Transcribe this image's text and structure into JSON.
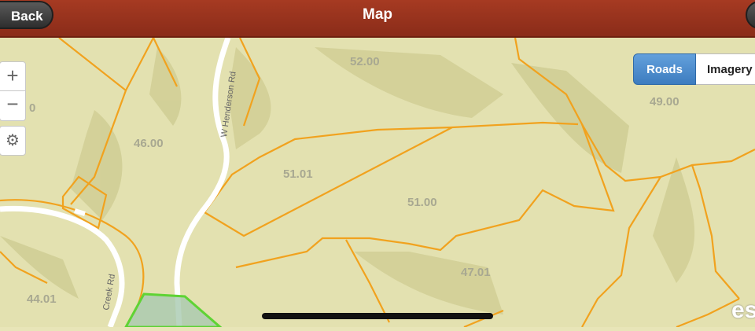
{
  "header": {
    "title": "Map",
    "back_label": "Back"
  },
  "controls": {
    "zoom_in": "+",
    "zoom_out": "−",
    "locate_icon": "locate-icon"
  },
  "basemap_toggle": {
    "roads": "Roads",
    "imagery": "Imagery",
    "selected": "Roads"
  },
  "parcels": {
    "p52_00": "52.00",
    "p49_00": "49.00",
    "p46_00": "46.00",
    "p51_01": "51.01",
    "p51_00": "51.00",
    "p47_01": "47.01",
    "p44_01": "44.01",
    "p_partial": "0"
  },
  "roads": {
    "henderson": "W Henderson Rd",
    "creek": "Creek Rd"
  },
  "attribution": "esri",
  "colors": {
    "header": "#962f1b",
    "parcel_line": "#f1a21e",
    "selected_parcel": "#5fd334",
    "terrain": "#e3e1b0"
  }
}
